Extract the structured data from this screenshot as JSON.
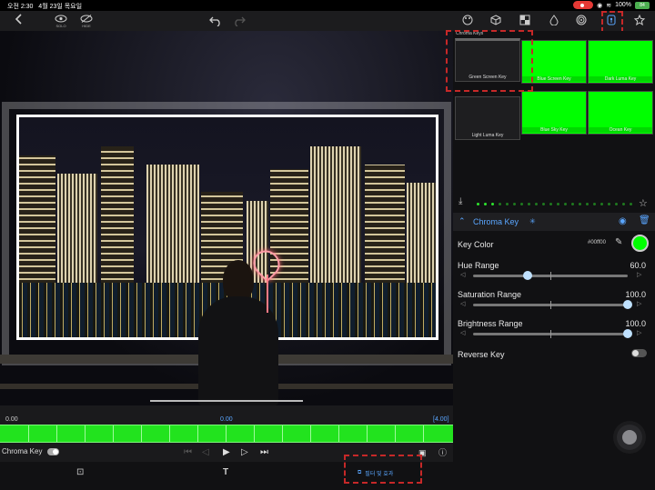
{
  "status": {
    "time": "오전 2:30",
    "date": "4월 23일 목요일",
    "battery_pct": "100%",
    "battery_badge": "84"
  },
  "toolbar": {
    "eye_label": "SOLO",
    "eye_off_label": "HIDE",
    "left_icons": [
      "chevron-left-icon",
      "eye-icon",
      "eye-off-icon"
    ],
    "center_icons": [
      "undo-icon",
      "redo-icon"
    ],
    "right_icons": [
      "palette-icon",
      "cube-icon",
      "grid-icon",
      "droplet-icon",
      "target-icon",
      "keyhole-icon",
      "star-icon"
    ]
  },
  "preview": {
    "scene": "night-city-skyline"
  },
  "timeline": {
    "start_time": "0.00",
    "current_time": "0.00",
    "end_time": "[4.00]",
    "layer_name": "Chroma Key",
    "accent_color": "#22e31e"
  },
  "bottombar": {
    "fx_label": "필터 및 효과"
  },
  "presets": {
    "group_name": "Chroma Keys",
    "items": [
      {
        "label": "Green Screen Key",
        "style": "dark"
      },
      {
        "label": "Blue Screen Key",
        "style": "green"
      },
      {
        "label": "Dark Luma Key",
        "style": "green"
      },
      {
        "label": "Light Luma Key",
        "style": "dark"
      },
      {
        "label": "Blue Sky Key",
        "style": "green"
      },
      {
        "label": "Ocean Key",
        "style": "green"
      }
    ]
  },
  "effect": {
    "title": "Chroma Key",
    "key_color_label": "Key Color",
    "key_color_hex": "#00ff00",
    "key_color_value": "#00ff00",
    "hue_range_label": "Hue Range",
    "hue_range_value": "60.0",
    "hue_range_fraction": 0.35,
    "saturation_label": "Saturation Range",
    "saturation_value": "100.0",
    "saturation_fraction": 1.0,
    "brightness_label": "Brightness Range",
    "brightness_value": "100.0",
    "brightness_fraction": 1.0,
    "reverse_key_label": "Reverse Key",
    "reverse_key_on": false
  }
}
